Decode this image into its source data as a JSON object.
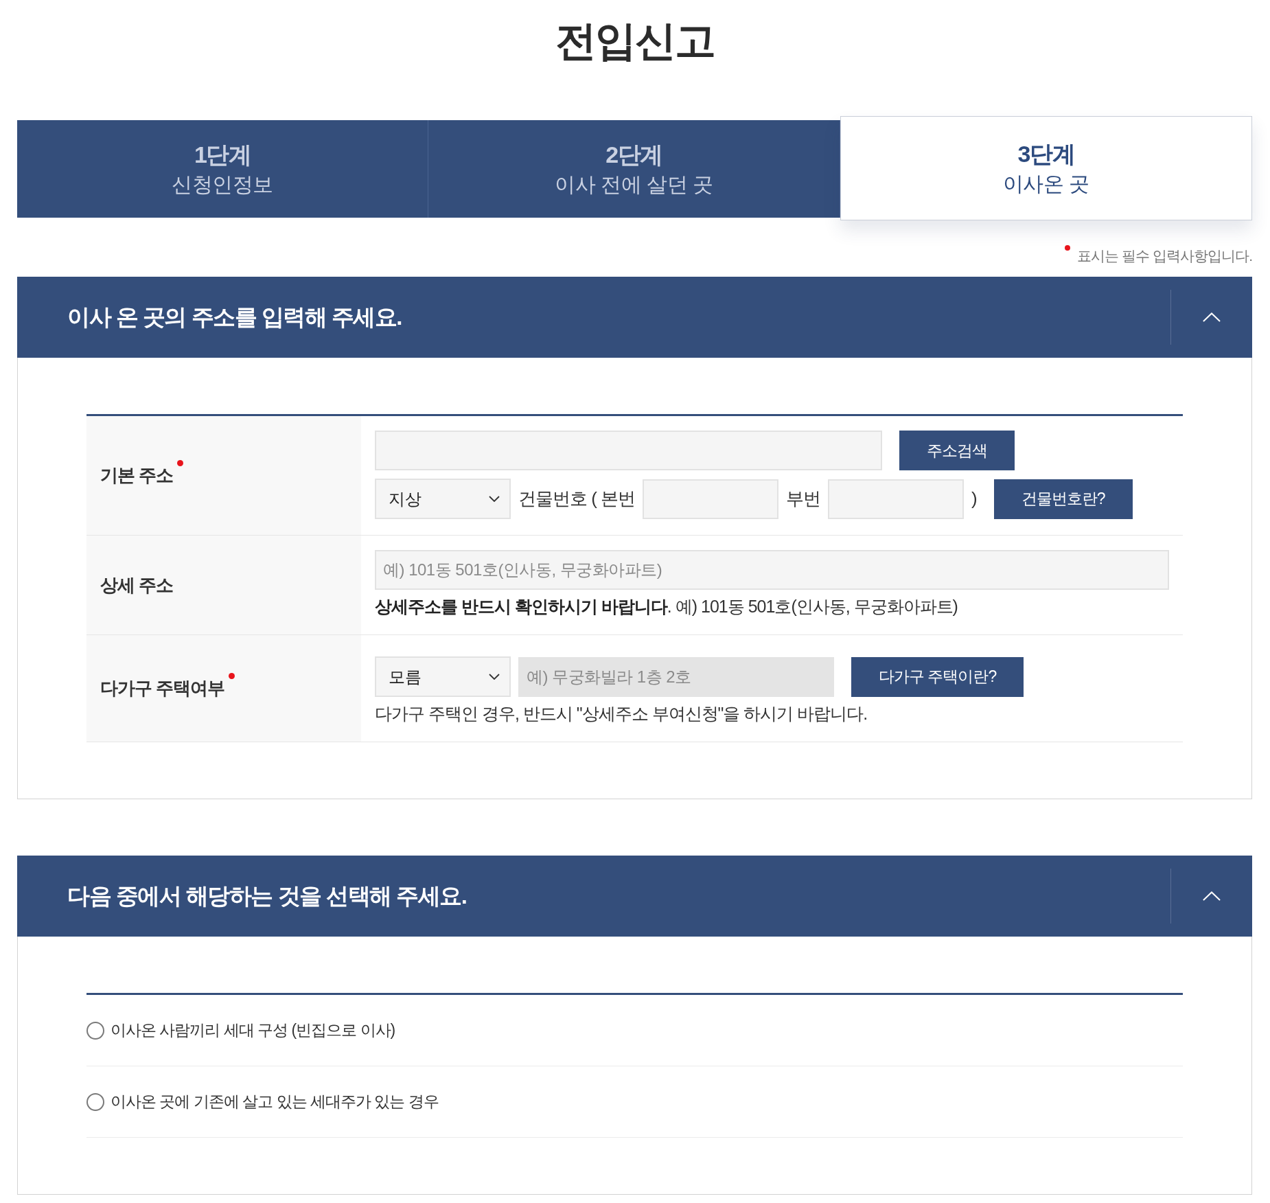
{
  "page_title": "전입신고",
  "steps": [
    {
      "number": "1단계",
      "label": "신청인정보",
      "selected": false
    },
    {
      "number": "2단계",
      "label": "이사 전에 살던 곳",
      "selected": false
    },
    {
      "number": "3단계",
      "label": "이사온 곳",
      "selected": true
    }
  ],
  "required_note": "표시는 필수 입력사항입니다.",
  "sections": [
    {
      "kind": "form",
      "title": "이사 온 곳의 주소를 입력해 주세요.",
      "expanded": true,
      "rows": [
        {
          "label": "기본 주소",
          "required": true,
          "lines": [
            [
              {
                "kind": "longfield",
                "disabled": false
              },
              {
                "kind": "button",
                "label": "주소검색"
              }
            ],
            [
              {
                "kind": "select",
                "value": "지상",
                "disabled": false
              },
              {
                "kind": "text",
                "text": "건물번호 ( 본번"
              },
              {
                "kind": "shortfield",
                "disabled": false
              },
              {
                "kind": "text",
                "text": "부번"
              },
              {
                "kind": "shortfield",
                "disabled": false
              },
              {
                "kind": "text",
                "text": ")"
              },
              {
                "kind": "button",
                "label": "건물번호란?"
              }
            ]
          ]
        },
        {
          "label": "상세 주소",
          "required": false,
          "lines": [
            [
              {
                "kind": "fullfield",
                "placeholder": "예) 101동 501호(인사동, 무궁화아파트)",
                "disabled": false
              }
            ]
          ],
          "note": "**상세주소를 반드시 확인하시기 바랍니다**. 예) 101동 501호(인사동, 무궁화아파트)"
        },
        {
          "label": "다가구 주택여부",
          "required": true,
          "lines": [
            [
              {
                "kind": "select",
                "value": "모름",
                "disabled": false
              },
              {
                "kind": "midfield",
                "placeholder": "예) 무궁화빌라 1층 2호",
                "disabled": true
              },
              {
                "kind": "button",
                "label": "다가구 주택이란?"
              }
            ]
          ],
          "note": "다가구 주택인 경우, 반드시 \"상세주소 부여신청\"을 하시기 바랍니다."
        }
      ]
    },
    {
      "kind": "choice",
      "title": "다음 중에서 해당하는 것을 선택해 주세요.",
      "expanded": true,
      "options": [
        {
          "label": "이사온 사람끼리 세대 구성 (빈집으로 이사)",
          "selected": false
        },
        {
          "label": "이사온 곳에 기존에 살고 있는 세대주가 있는 경우",
          "selected": false
        }
      ]
    }
  ]
}
